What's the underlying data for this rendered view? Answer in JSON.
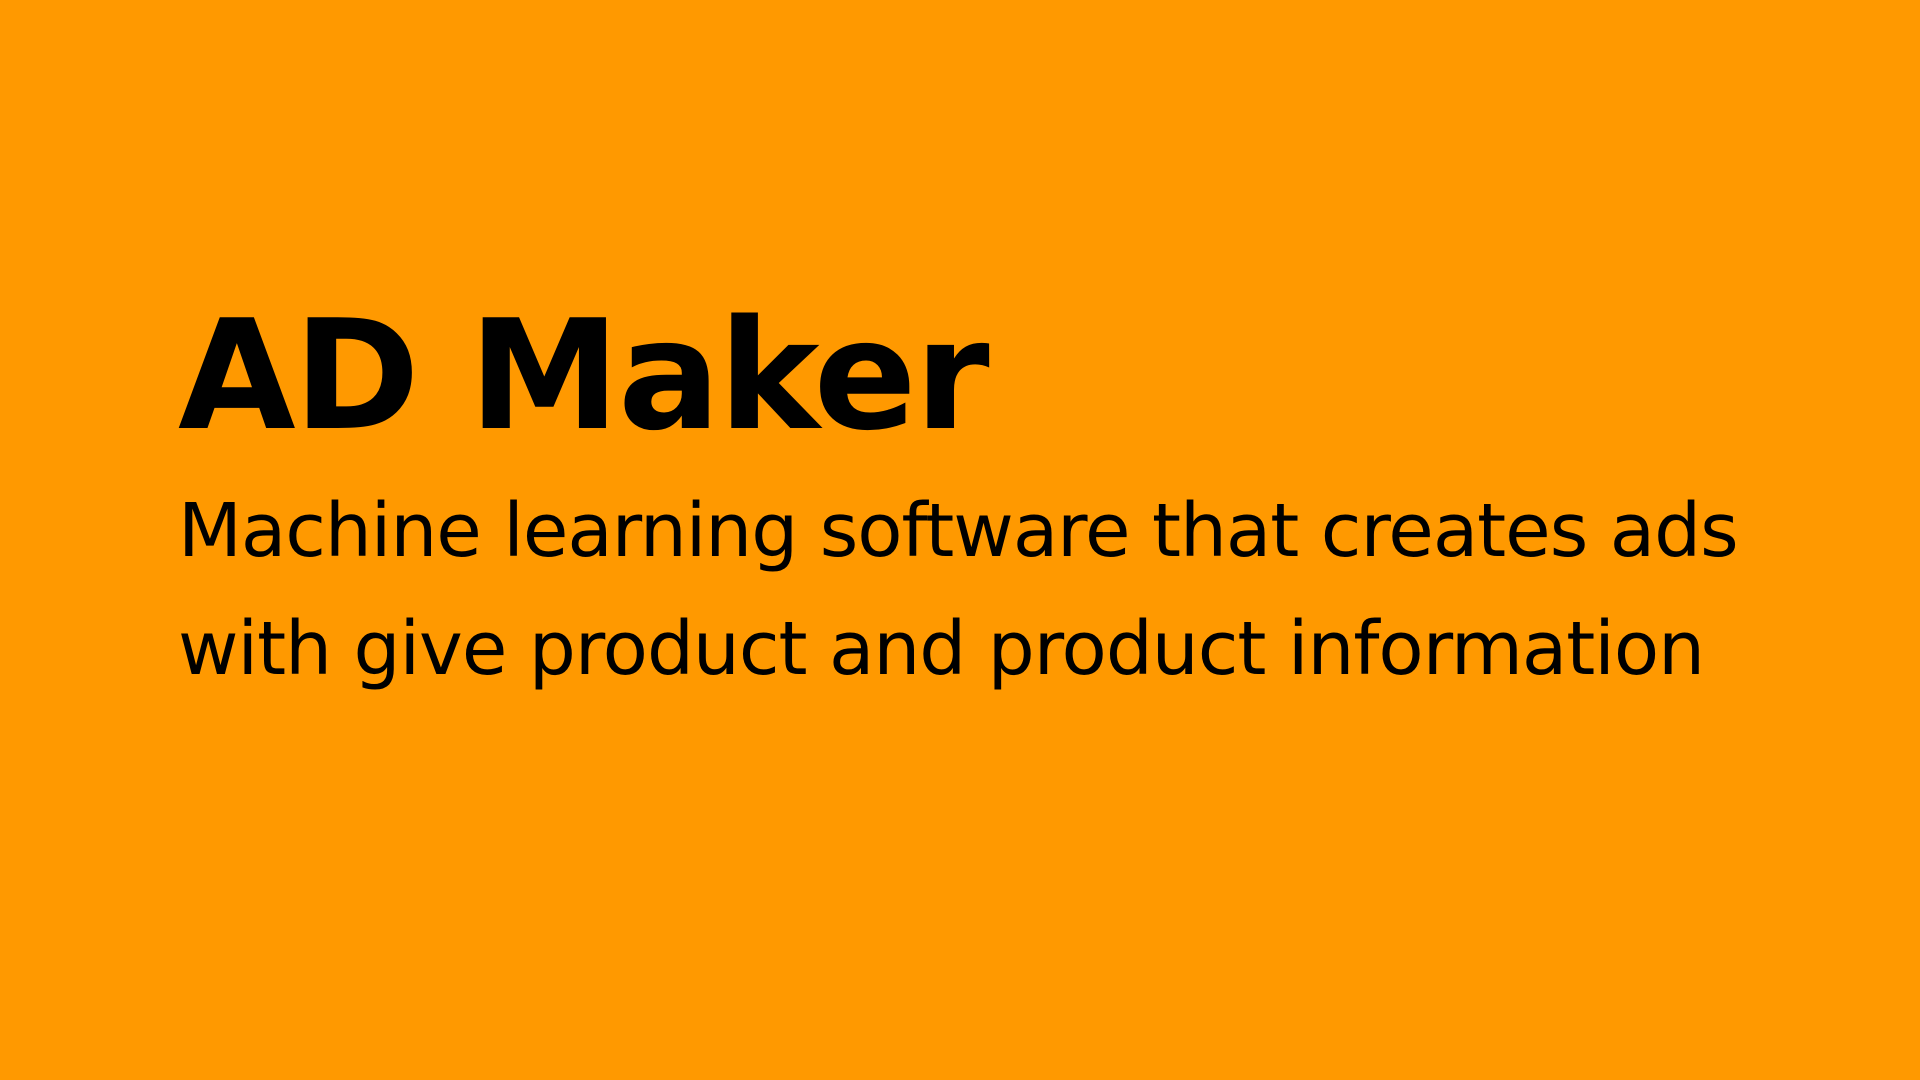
{
  "slide": {
    "title": "AD Maker",
    "description": "Machine learning software that creates ads with give product and product information"
  },
  "colors": {
    "background": "#FF9900",
    "text": "#000000"
  }
}
